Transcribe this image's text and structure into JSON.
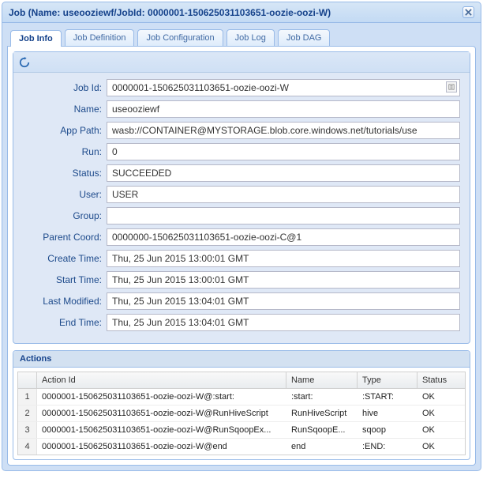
{
  "window": {
    "title": "Job (Name: useooziewf/JobId: 0000001-150625031103651-oozie-oozi-W)"
  },
  "tabs": {
    "info": "Job Info",
    "definition": "Job Definition",
    "configuration": "Job Configuration",
    "log": "Job Log",
    "dag": "Job DAG"
  },
  "form": {
    "labels": {
      "job_id": "Job Id:",
      "name": "Name:",
      "app_path": "App Path:",
      "run": "Run:",
      "status": "Status:",
      "user": "User:",
      "group": "Group:",
      "parent_coord": "Parent Coord:",
      "create_time": "Create Time:",
      "start_time": "Start Time:",
      "last_modified": "Last Modified:",
      "end_time": "End Time:"
    },
    "values": {
      "job_id": "0000001-150625031103651-oozie-oozi-W",
      "name": "useooziewf",
      "app_path": "wasb://CONTAINER@MYSTORAGE.blob.core.windows.net/tutorials/use",
      "run": "0",
      "status": "SUCCEEDED",
      "user": "USER",
      "group": "",
      "parent_coord": "0000000-150625031103651-oozie-oozi-C@1",
      "create_time": "Thu, 25 Jun 2015 13:00:01 GMT",
      "start_time": "Thu, 25 Jun 2015 13:00:01 GMT",
      "last_modified": "Thu, 25 Jun 2015 13:04:01 GMT",
      "end_time": "Thu, 25 Jun 2015 13:04:01 GMT"
    }
  },
  "actions": {
    "title": "Actions",
    "headers": {
      "action_id": "Action Id",
      "name": "Name",
      "type": "Type",
      "status": "Status"
    },
    "rows": [
      {
        "n": "1",
        "action_id": "0000001-150625031103651-oozie-oozi-W@:start:",
        "name": ":start:",
        "type": ":START:",
        "status": "OK"
      },
      {
        "n": "2",
        "action_id": "0000001-150625031103651-oozie-oozi-W@RunHiveScript",
        "name": "RunHiveScript",
        "type": "hive",
        "status": "OK"
      },
      {
        "n": "3",
        "action_id": "0000001-150625031103651-oozie-oozi-W@RunSqoopEx...",
        "name": "RunSqoopE...",
        "type": "sqoop",
        "status": "OK"
      },
      {
        "n": "4",
        "action_id": "0000001-150625031103651-oozie-oozi-W@end",
        "name": "end",
        "type": ":END:",
        "status": "OK"
      }
    ]
  }
}
